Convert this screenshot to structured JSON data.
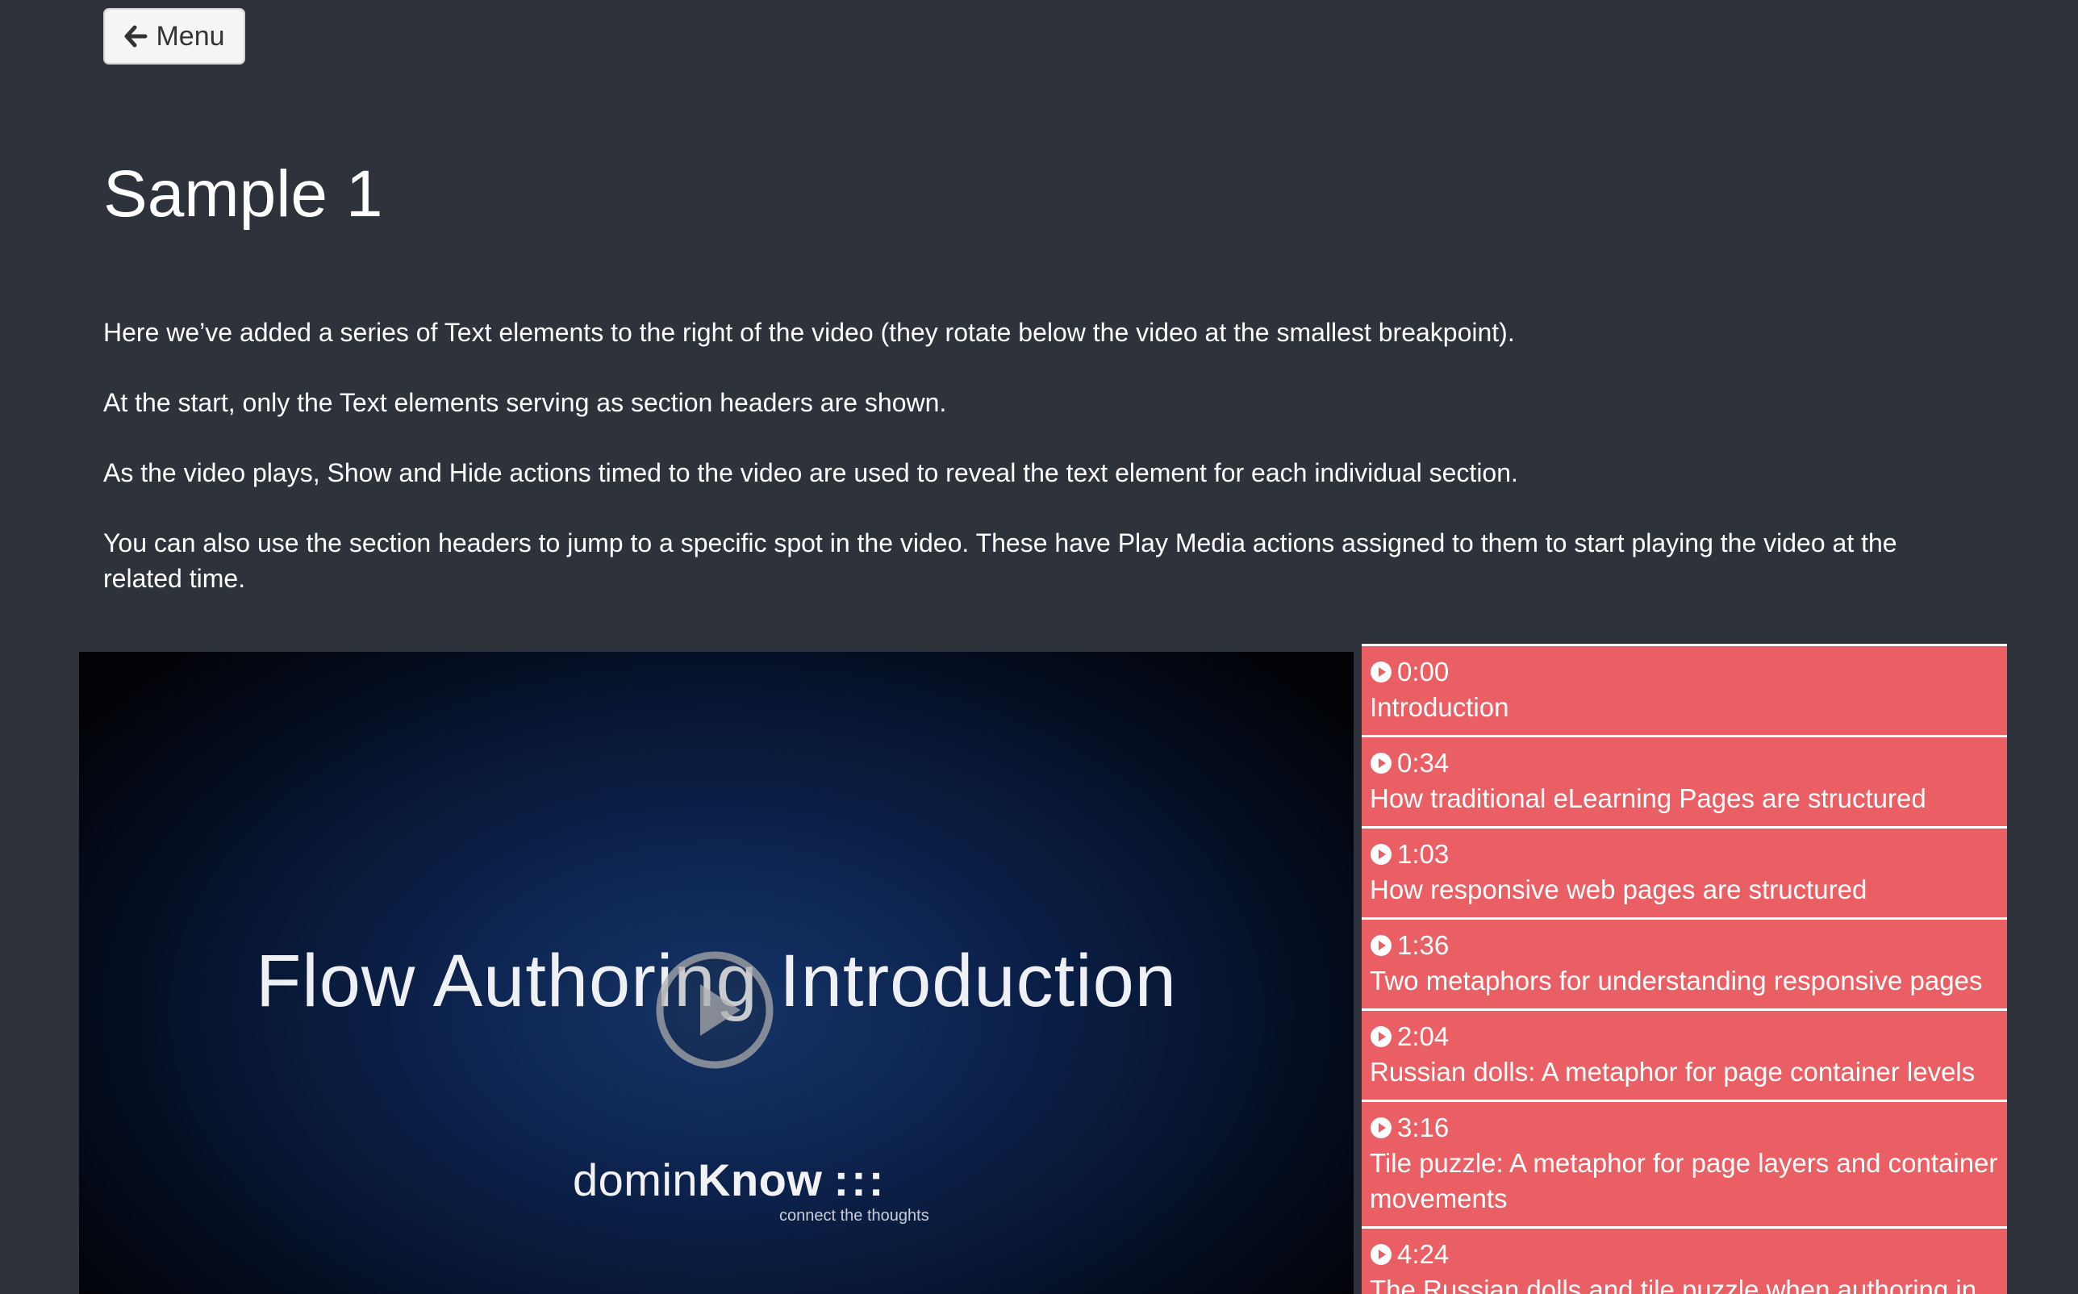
{
  "header": {
    "menu_label": "Menu",
    "menu_icon": "arrow-left-icon"
  },
  "page": {
    "title": "Sample 1"
  },
  "intro": {
    "paragraphs": [
      "Here we’ve added a series of Text elements to the right of the video (they rotate below the video at the smallest breakpoint).",
      "At the start, only the Text elements serving as section headers are shown.",
      "As the video plays, Show and Hide actions timed to the video are used to reveal the text element for each individual section.",
      "You can also use the section headers to jump to a specific spot in the video. These have Play Media actions assigned to them to start playing the video at the related time."
    ]
  },
  "video": {
    "title": "Flow Authoring Introduction",
    "brand_prefix": "domin",
    "brand_strong": "Know",
    "brand_dots": ":::",
    "tagline": "connect the thoughts",
    "play_icon": "play-circle-icon"
  },
  "sections": {
    "accent_color": "#ea5f64",
    "icon": "play-circle-icon",
    "items": [
      {
        "time": "0:00",
        "title": "Introduction"
      },
      {
        "time": "0:34",
        "title": "How traditional eLearning Pages are structured"
      },
      {
        "time": "1:03",
        "title": "How responsive web pages are structured"
      },
      {
        "time": "1:36",
        "title": "Two metaphors for understanding responsive pages"
      },
      {
        "time": "2:04",
        "title": "Russian dolls: A metaphor for page container levels"
      },
      {
        "time": "3:16",
        "title": "Tile puzzle: A metaphor for page layers and container movements"
      },
      {
        "time": "4:24",
        "title": "The Russian dolls and tile puzzle when authoring in"
      }
    ]
  }
}
